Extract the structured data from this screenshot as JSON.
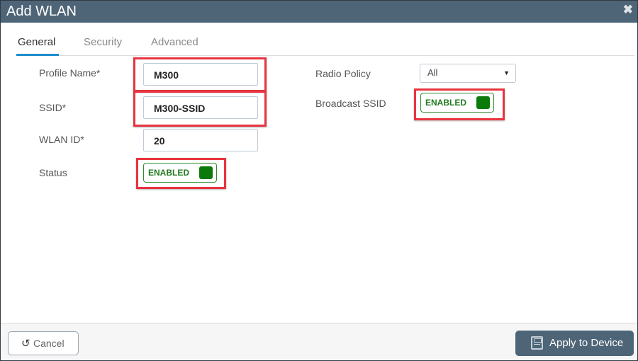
{
  "dialog": {
    "title": "Add WLAN",
    "close_icon": "close-icon"
  },
  "tabs": [
    {
      "label": "General",
      "active": true
    },
    {
      "label": "Security",
      "active": false
    },
    {
      "label": "Advanced",
      "active": false
    }
  ],
  "general": {
    "profile_name": {
      "label": "Profile Name*",
      "value": "M300"
    },
    "ssid": {
      "label": "SSID*",
      "value": "M300-SSID"
    },
    "wlan_id": {
      "label": "WLAN ID*",
      "value": "20"
    },
    "status": {
      "label": "Status",
      "value": "ENABLED"
    },
    "radio_policy": {
      "label": "Radio Policy",
      "value": "All"
    },
    "broadcast_ssid": {
      "label": "Broadcast SSID",
      "value": "ENABLED"
    }
  },
  "colors": {
    "titlebar": "#4e6577",
    "highlight": "#e8343f",
    "toggle_on": "#0b7a0b",
    "tab_active": "#1e8ccd"
  },
  "footer": {
    "cancel_label": "Cancel",
    "cancel_icon": "undo-icon",
    "apply_label": "Apply to Device",
    "apply_icon": "save-icon"
  }
}
